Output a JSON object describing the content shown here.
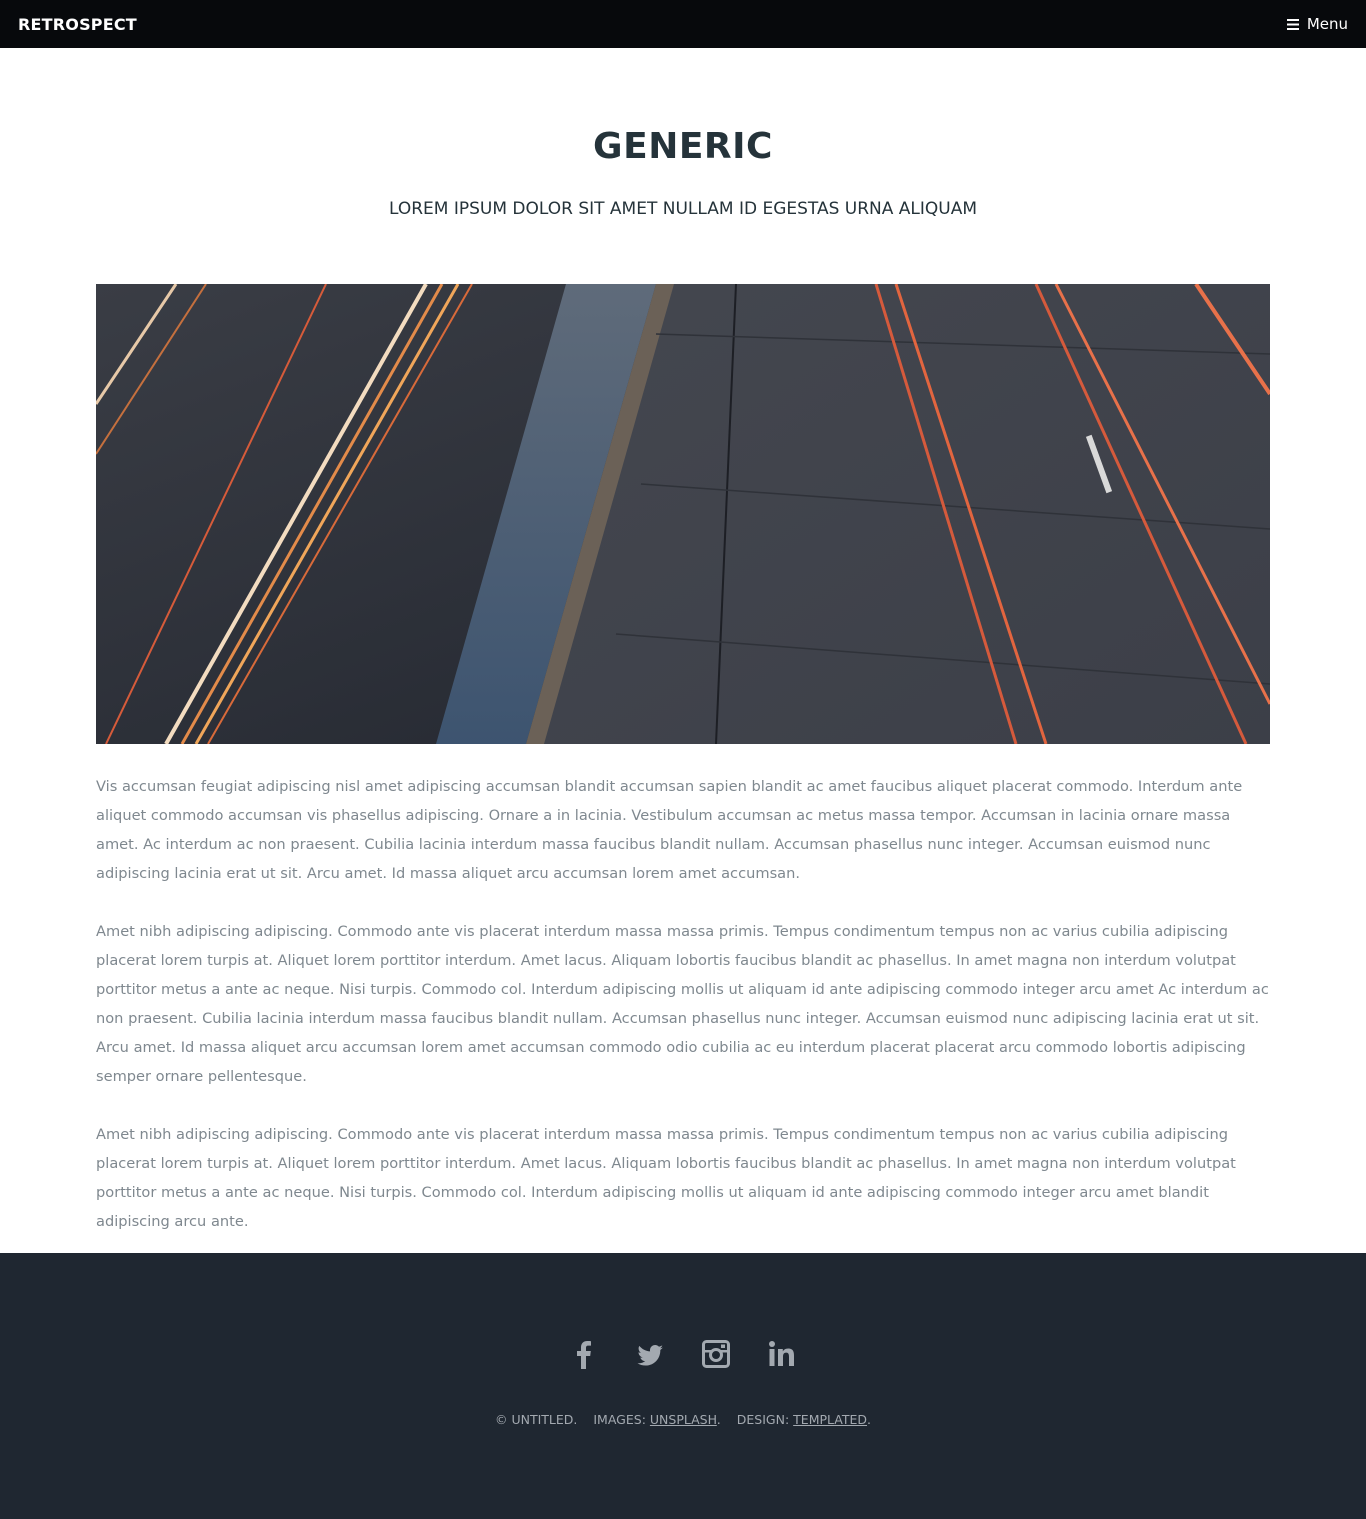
{
  "header": {
    "logo": "RETROSPECT",
    "menu_label": "Menu"
  },
  "main": {
    "title": "GENERIC",
    "subtitle": "LOREM IPSUM DOLOR SIT AMET NULLAM ID EGESTAS URNA ALIQUAM",
    "image": {
      "icon": "highway-light-trails-photo"
    },
    "paragraphs": [
      "Vis accumsan feugiat adipiscing nisl amet adipiscing accumsan blandit accumsan sapien blandit ac amet faucibus aliquet placerat commodo. Interdum ante aliquet commodo accumsan vis phasellus adipiscing. Ornare a in lacinia. Vestibulum accumsan ac metus massa tempor. Accumsan in lacinia ornare massa amet. Ac interdum ac non praesent. Cubilia lacinia interdum massa faucibus blandit nullam. Accumsan phasellus nunc integer. Accumsan euismod nunc adipiscing lacinia erat ut sit. Arcu amet. Id massa aliquet arcu accumsan lorem amet accumsan.",
      "Amet nibh adipiscing adipiscing. Commodo ante vis placerat interdum massa massa primis. Tempus condimentum tempus non ac varius cubilia adipiscing placerat lorem turpis at. Aliquet lorem porttitor interdum. Amet lacus. Aliquam lobortis faucibus blandit ac phasellus. In amet magna non interdum volutpat porttitor metus a ante ac neque. Nisi turpis. Commodo col. Interdum adipiscing mollis ut aliquam id ante adipiscing commodo integer arcu amet Ac interdum ac non praesent. Cubilia lacinia interdum massa faucibus blandit nullam. Accumsan phasellus nunc integer. Accumsan euismod nunc adipiscing lacinia erat ut sit. Arcu amet. Id massa aliquet arcu accumsan lorem amet accumsan commodo odio cubilia ac eu interdum placerat placerat arcu commodo lobortis adipiscing semper ornare pellentesque.",
      "Amet nibh adipiscing adipiscing. Commodo ante vis placerat interdum massa massa primis. Tempus condimentum tempus non ac varius cubilia adipiscing placerat lorem turpis at. Aliquet lorem porttitor interdum. Amet lacus. Aliquam lobortis faucibus blandit ac phasellus. In amet magna non interdum volutpat porttitor metus a ante ac neque. Nisi turpis. Commodo col. Interdum adipiscing mollis ut aliquam id ante adipiscing commodo integer arcu amet blandit adipiscing arcu ante."
    ]
  },
  "footer": {
    "social_icons": [
      "facebook-icon",
      "twitter-icon",
      "instagram-icon",
      "linkedin-icon"
    ],
    "copyright": "© UNTITLED.",
    "images_label": "IMAGES:",
    "images_link": "UNSPLASH",
    "design_label": "DESIGN:",
    "design_link": "TEMPLATED",
    "period": "."
  },
  "colors": {
    "header_bg": "#07090c",
    "heading": "#25333a",
    "body_text": "#7f888f",
    "footer_bg": "#1f2731",
    "footer_text": "#a3a9b0"
  }
}
